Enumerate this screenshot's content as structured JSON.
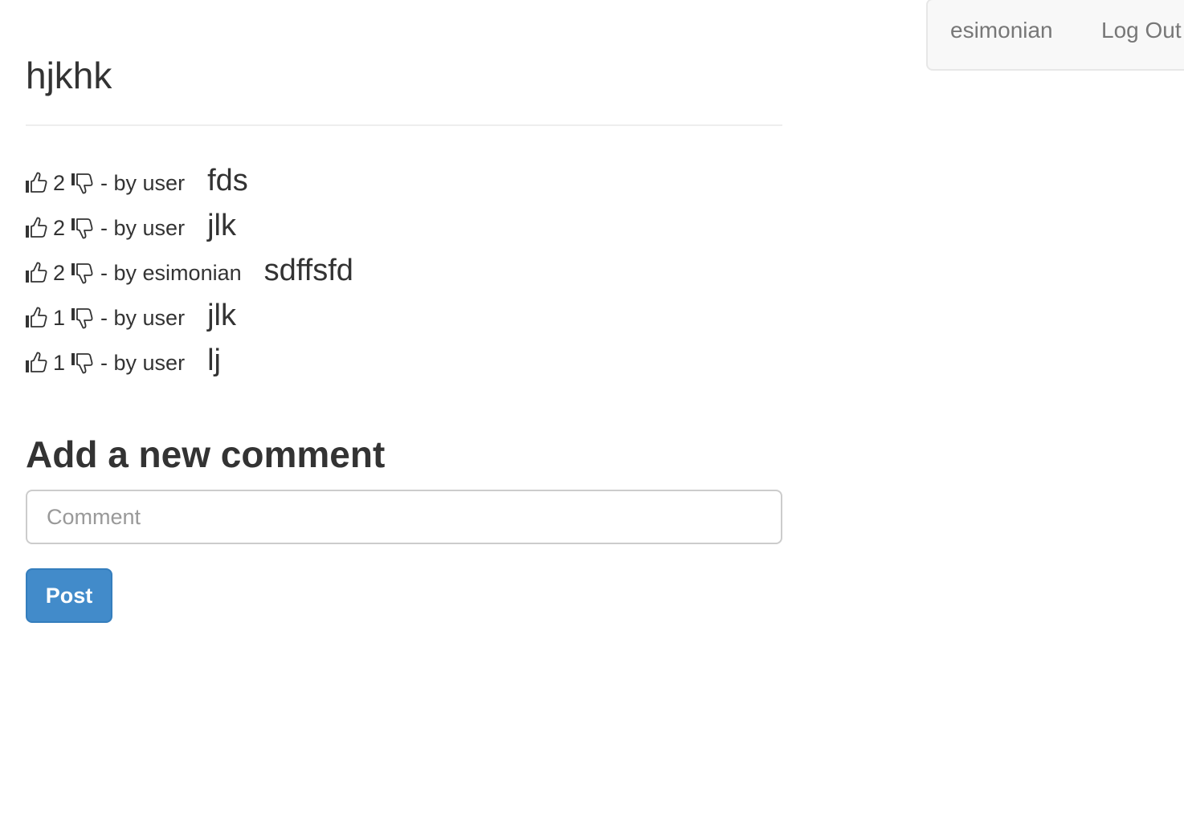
{
  "navbar": {
    "username": "esimonian",
    "logout_label": "Log Out"
  },
  "post": {
    "title": "hjkhk"
  },
  "comments": [
    {
      "score": "2",
      "author_prefix": "- by user",
      "text": "fds"
    },
    {
      "score": "2",
      "author_prefix": "- by user",
      "text": "jlk"
    },
    {
      "score": "2",
      "author_prefix": "- by esimonian",
      "text": "sdffsfd"
    },
    {
      "score": "1",
      "author_prefix": "- by user",
      "text": "jlk"
    },
    {
      "score": "1",
      "author_prefix": "- by user",
      "text": "lj"
    }
  ],
  "icons": {
    "upvote": "thumbs-up-icon",
    "downvote": "thumbs-down-icon"
  },
  "new_comment": {
    "heading": "Add a new comment",
    "placeholder": "Comment",
    "value": "",
    "submit_label": "Post"
  },
  "colors": {
    "primary_button": "#428bca",
    "navbar_bg": "#f8f8f8",
    "nav_link": "#777777",
    "text": "#333333"
  }
}
